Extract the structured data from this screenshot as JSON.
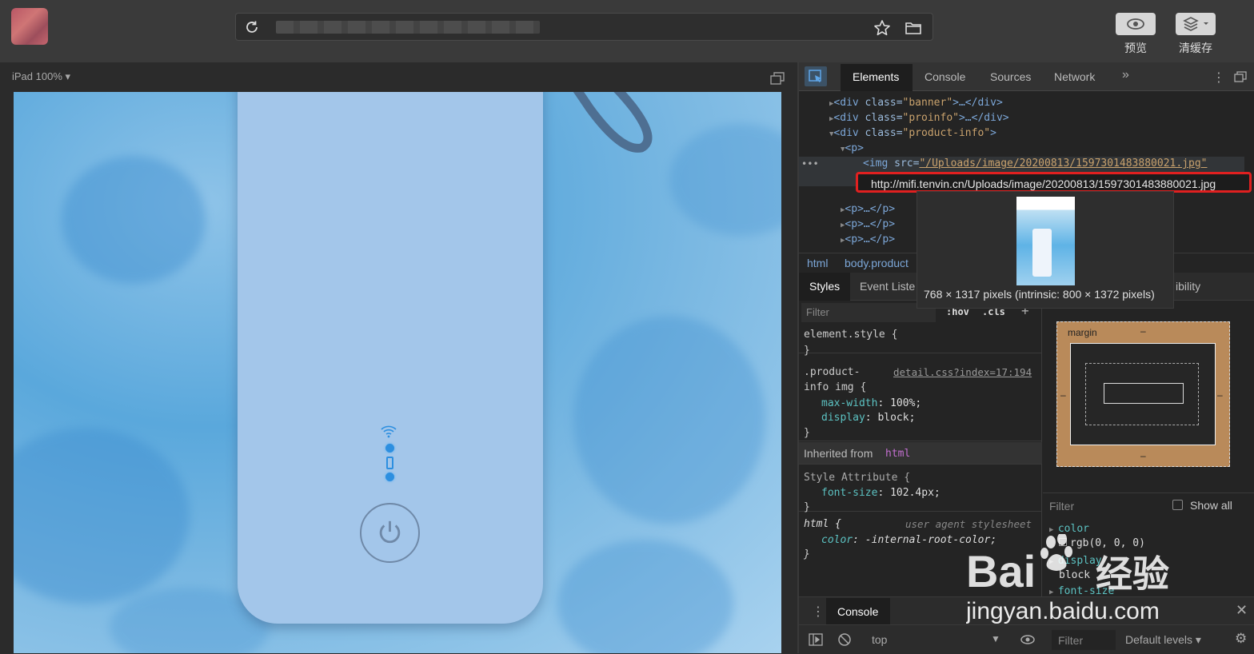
{
  "toolbar": {
    "url": "",
    "preview_label": "预览",
    "clear_cache_label": "清缓存"
  },
  "preview": {
    "device_label": "iPad 100% ▾"
  },
  "devtools": {
    "tabs": [
      "Elements",
      "Console",
      "Sources",
      "Network"
    ],
    "dom": {
      "line1_tag_open": "<div",
      "line1_attr": " class=",
      "line1_val": "\"banner\"",
      "line1_tail": ">…</div>",
      "line2_val": "\"proinfo\"",
      "line3_val": "\"product-info\"",
      "line3_tail": ">",
      "line4": "<p>",
      "line5_tag": "<img",
      "line5_attr": " src=",
      "line5_val": "\"/Uploads/image/20200813/1597301483880021.jpg\"",
      "collapsed_p": "<p>…</p>"
    },
    "hover_url": "http://mifi.tenvin.cn/Uploads/image/20200813/1597301483880021.jpg",
    "image_dims": "768 × 1317 pixels (intrinsic: 800 × 1372 pixels)",
    "breadcrumb": [
      "html",
      "body.product"
    ],
    "styles_tabs": [
      "Styles",
      "Event Liste",
      "ibility"
    ],
    "filter_placeholder": "Filter",
    "hov_label": ":hov",
    "cls_label": ".cls",
    "rules": {
      "element_style": "element.style {",
      "close_brace": "}",
      "product_selector_1": ".product-",
      "product_selector_2": "info img {",
      "product_source": "detail.css?index=17:194",
      "max_width_prop": "max-width",
      "max_width_val": "100%;",
      "display_prop": "display",
      "display_val": "block;",
      "inherited_label": "Inherited from",
      "inherited_tag": "html",
      "style_attr": "Style Attribute {",
      "font_size_prop": "font-size",
      "font_size_val": "102.4px;",
      "html_selector": "html {",
      "ua_label": "user agent stylesheet",
      "color_prop": "color",
      "color_val": "-internal-root-color;"
    },
    "box_model": {
      "margin_label": "margin",
      "dash": "–"
    },
    "computed": {
      "filter_placeholder": "Filter",
      "show_all_label": "Show all",
      "items": [
        {
          "prop": "color",
          "val": "rgb(0, 0, 0)"
        },
        {
          "prop": "display",
          "val": "block"
        },
        {
          "prop": "font-size",
          "val": ""
        }
      ]
    },
    "console": {
      "tab_label": "Console",
      "context": "top",
      "filter_placeholder": "Filter",
      "levels": "Default levels ▾"
    }
  },
  "watermark": {
    "brand": "Bai",
    "brand2": "经验",
    "site": "jingyan.baidu.com"
  }
}
